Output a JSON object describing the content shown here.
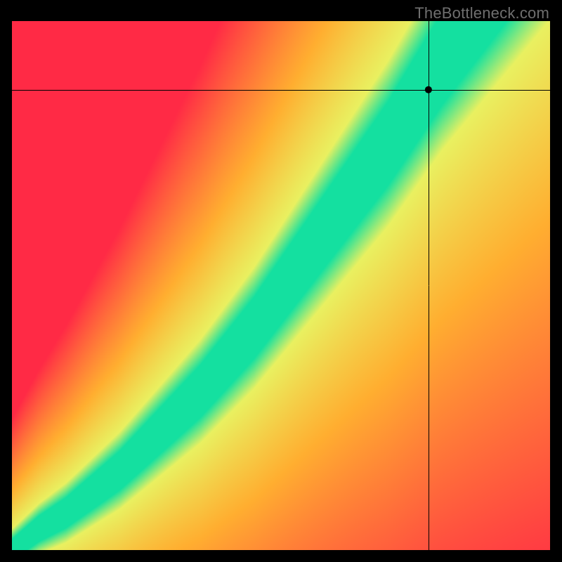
{
  "watermark": "TheBottleneck.com",
  "chart_data": {
    "type": "heatmap",
    "title": "",
    "xlabel": "",
    "ylabel": "",
    "xlim": [
      0,
      1
    ],
    "ylim": [
      0,
      1
    ],
    "ridge": {
      "description": "Optimal-match curve (green ridge) y as function of x, normalized 0..1 from bottom-left origin",
      "points": [
        {
          "x": 0.0,
          "y": 0.0
        },
        {
          "x": 0.05,
          "y": 0.04
        },
        {
          "x": 0.1,
          "y": 0.07
        },
        {
          "x": 0.15,
          "y": 0.11
        },
        {
          "x": 0.2,
          "y": 0.15
        },
        {
          "x": 0.25,
          "y": 0.2
        },
        {
          "x": 0.3,
          "y": 0.25
        },
        {
          "x": 0.35,
          "y": 0.3
        },
        {
          "x": 0.4,
          "y": 0.36
        },
        {
          "x": 0.45,
          "y": 0.42
        },
        {
          "x": 0.5,
          "y": 0.49
        },
        {
          "x": 0.55,
          "y": 0.56
        },
        {
          "x": 0.6,
          "y": 0.63
        },
        {
          "x": 0.65,
          "y": 0.7
        },
        {
          "x": 0.7,
          "y": 0.77
        },
        {
          "x": 0.75,
          "y": 0.85
        },
        {
          "x": 0.8,
          "y": 0.93
        },
        {
          "x": 0.85,
          "y": 1.0
        }
      ]
    },
    "marker": {
      "x": 0.775,
      "y": 0.87
    },
    "crosshair": {
      "x": 0.775,
      "y": 0.87
    },
    "colors": {
      "best": "#14e0a0",
      "good": "#e9f060",
      "mid": "#ffae30",
      "bad": "#ff2a45"
    }
  }
}
